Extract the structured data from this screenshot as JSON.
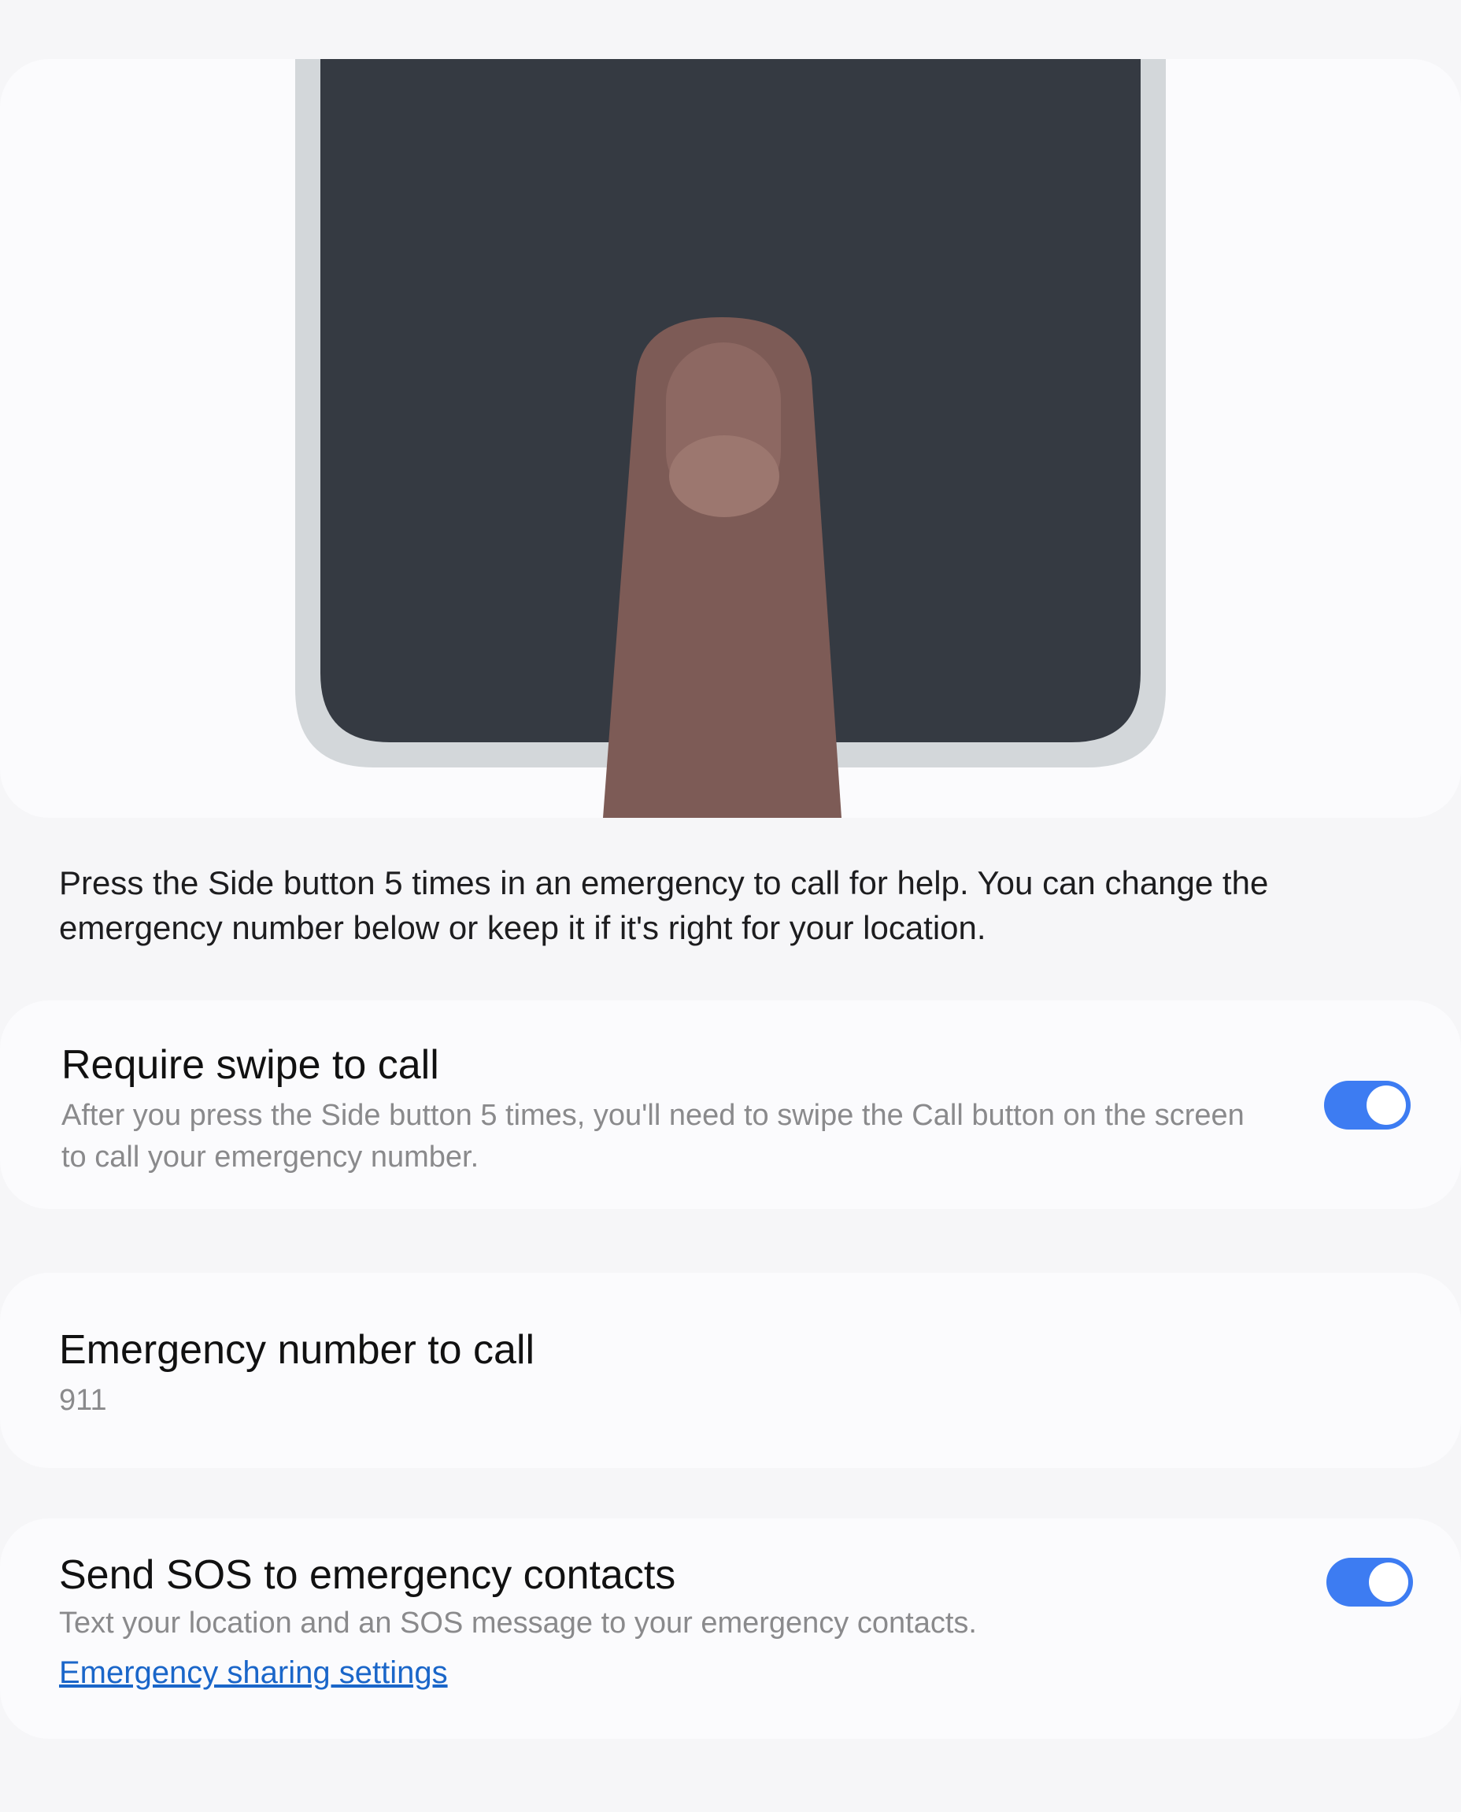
{
  "description": "Press the Side button 5 times in an emergency to call for help. You can change the emergency number below or keep it if it's right for your location.",
  "require_swipe": {
    "title": "Require swipe to call",
    "subtitle": "After you press the Side button 5 times, you'll need to swipe the Call button on the screen to call your emergency number.",
    "enabled": true
  },
  "emergency_number": {
    "title": "Emergency number to call",
    "value": "911"
  },
  "send_sos": {
    "title": "Send SOS to emergency contacts",
    "subtitle": "Text your location and an SOS message to your emergency contacts.",
    "link": "Emergency sharing settings",
    "enabled": true
  },
  "colors": {
    "background": "#f6f6f8",
    "card": "#fbfbfd",
    "accent": "#3d7cf2",
    "link": "#1a66c9",
    "phone_screen": "#353a42",
    "phone_frame": "#d3d7da",
    "finger": "#7d5b56"
  }
}
